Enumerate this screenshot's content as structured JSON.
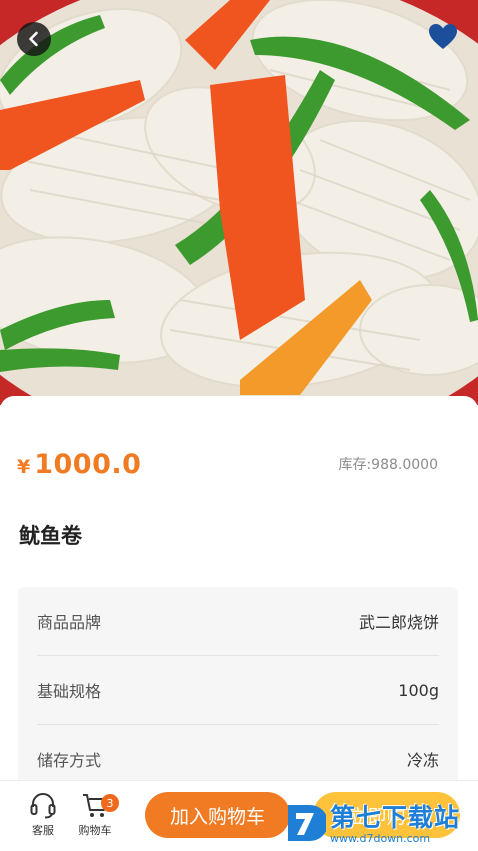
{
  "hero": {
    "image_desc": "stir-fried squid rolls with snow peas and carrots",
    "colors": {
      "plate": "#c62828",
      "squid": "#f3efe6",
      "pea": "#3c9a2e",
      "carrot": "#f0551f"
    }
  },
  "header": {
    "back_icon": "chevron-left-icon",
    "favorite_icon": "heart-icon",
    "favorite_color": "#1b4e9b"
  },
  "product": {
    "currency": "¥",
    "price": "1000.0",
    "stock": "库存:988.0000",
    "name": "鱿鱼卷"
  },
  "specs": [
    {
      "label": "商品品牌",
      "value": "武二郎烧饼"
    },
    {
      "label": "基础规格",
      "value": "100g"
    },
    {
      "label": "储存方式",
      "value": "冷冻"
    }
  ],
  "bottom_bar": {
    "service_label": "客服",
    "cart_label": "购物车",
    "cart_count": "3",
    "add_to_cart": "加入购物车",
    "buy_now": "立即购买",
    "accent_color": "#f07b23",
    "buy_color": "#ffc23a"
  },
  "watermark": {
    "title": "第七下载站",
    "url": "www.d7down.com"
  }
}
